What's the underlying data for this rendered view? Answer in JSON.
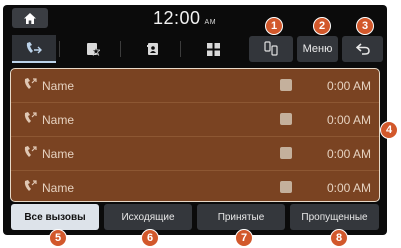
{
  "status": {
    "home_icon": "home-icon",
    "time": "12:00",
    "ampm": "AM"
  },
  "toolbar": {
    "tabs": [
      {
        "icon": "call-history-icon",
        "active": true
      },
      {
        "icon": "contacts-star-icon",
        "active": false
      },
      {
        "icon": "contacts-book-icon",
        "active": false
      },
      {
        "icon": "keypad-icon",
        "active": false
      }
    ],
    "device_icon": "phone-switch-icon",
    "menu_label": "Меню",
    "back_icon": "back-icon"
  },
  "calls": [
    {
      "icon": "outgoing-call-icon",
      "name": "Name",
      "time": "0:00 AM",
      "type_icon": "mobile-icon"
    },
    {
      "icon": "outgoing-call-icon",
      "name": "Name",
      "time": "0:00 AM",
      "type_icon": "mobile-icon"
    },
    {
      "icon": "outgoing-call-icon",
      "name": "Name",
      "time": "0:00 AM",
      "type_icon": "mobile-icon"
    },
    {
      "icon": "outgoing-call-icon",
      "name": "Name",
      "time": "0:00 AM",
      "type_icon": "mobile-icon"
    }
  ],
  "filters": [
    {
      "label": "Все вызовы",
      "active": true
    },
    {
      "label": "Исходящие",
      "active": false
    },
    {
      "label": "Принятые",
      "active": false
    },
    {
      "label": "Пропущенные",
      "active": false
    }
  ],
  "callouts": [
    "1",
    "2",
    "3",
    "4",
    "5",
    "6",
    "7",
    "8"
  ],
  "colors": {
    "accent_callout": "#d2582b",
    "list_background": "#7a4322",
    "screen_background": "#0b0b0b"
  }
}
